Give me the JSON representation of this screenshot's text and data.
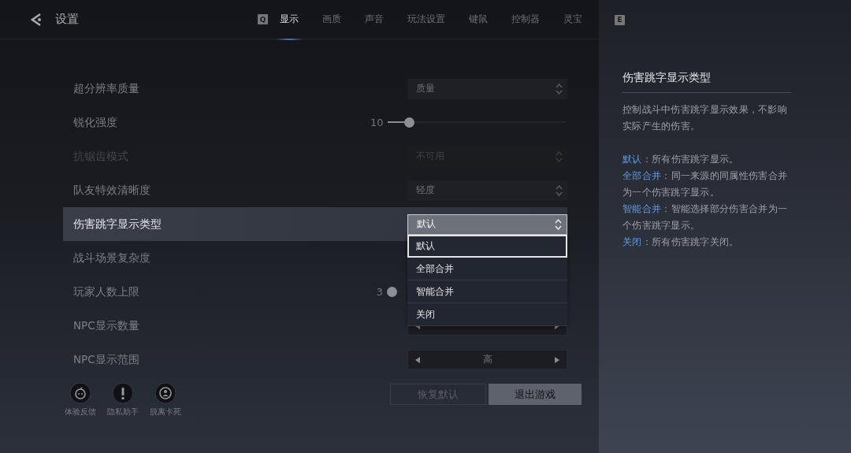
{
  "header": {
    "title": "设置",
    "tabs": [
      {
        "label": "显示",
        "selected": true
      },
      {
        "label": "画质",
        "selected": false
      },
      {
        "label": "声音",
        "selected": false
      },
      {
        "label": "玩法设置",
        "selected": false
      },
      {
        "label": "键鼠",
        "selected": false
      },
      {
        "label": "控制器",
        "selected": false
      },
      {
        "label": "灵宝",
        "selected": false
      }
    ],
    "prev_key": "Q",
    "next_key": "E"
  },
  "settings": [
    {
      "label": "超分辨率质量",
      "kind": "select",
      "value": "质量",
      "selected": false,
      "disabled": false
    },
    {
      "label": "锐化强度",
      "kind": "slider",
      "value": "10",
      "level": 0.12,
      "selected": false,
      "disabled": false
    },
    {
      "label": "抗锯齿模式",
      "kind": "select",
      "value": "不可用",
      "selected": false,
      "disabled": true
    },
    {
      "label": "队友特效清晰度",
      "kind": "select",
      "value": "轻度",
      "selected": false,
      "disabled": false
    },
    {
      "label": "伤害跳字显示类型",
      "kind": "select",
      "value": "默认",
      "selected": true,
      "disabled": false
    },
    {
      "label": "战斗场景复杂度",
      "kind": "hidden",
      "selected": false,
      "disabled": false
    },
    {
      "label": "玩家人数上限",
      "kind": "slider",
      "value": "3",
      "level": 0.02,
      "selected": false,
      "disabled": false
    },
    {
      "label": "NPC显示数量",
      "kind": "stepper",
      "selected": false,
      "disabled": false
    },
    {
      "label": "NPC显示范围",
      "kind": "stepper",
      "value": "高",
      "selected": false,
      "disabled": false
    }
  ],
  "dropdown": {
    "options": [
      {
        "label": "默认",
        "selected": true
      },
      {
        "label": "全部合并",
        "selected": false
      },
      {
        "label": "智能合并",
        "selected": false
      },
      {
        "label": "关闭",
        "selected": false
      }
    ]
  },
  "footer": {
    "tools": [
      {
        "label": "体验反馈",
        "kind": "feedback"
      },
      {
        "label": "隐私助手",
        "kind": "privacy"
      },
      {
        "label": "脱离卡死",
        "kind": "unstuck"
      }
    ],
    "buttons": [
      {
        "label": "恢复默认",
        "disabled": true
      },
      {
        "label": "退出游戏",
        "disabled": false
      }
    ]
  },
  "help": {
    "title": "伤害跳字显示类型",
    "intro": "控制战斗中伤害跳字显示效果，不影响实际产生的伤害。",
    "items": [
      {
        "term": "默认",
        "text": "：所有伤害跳字显示。"
      },
      {
        "term": "全部合并",
        "text": "：同一来源的同属性伤害合并为一个伤害跳字显示。"
      },
      {
        "term": "智能合并",
        "text": "：智能选择部分伤害合并为一个伤害跳字显示。"
      },
      {
        "term": "关闭",
        "text": "：所有伤害跳字关闭。"
      }
    ]
  }
}
